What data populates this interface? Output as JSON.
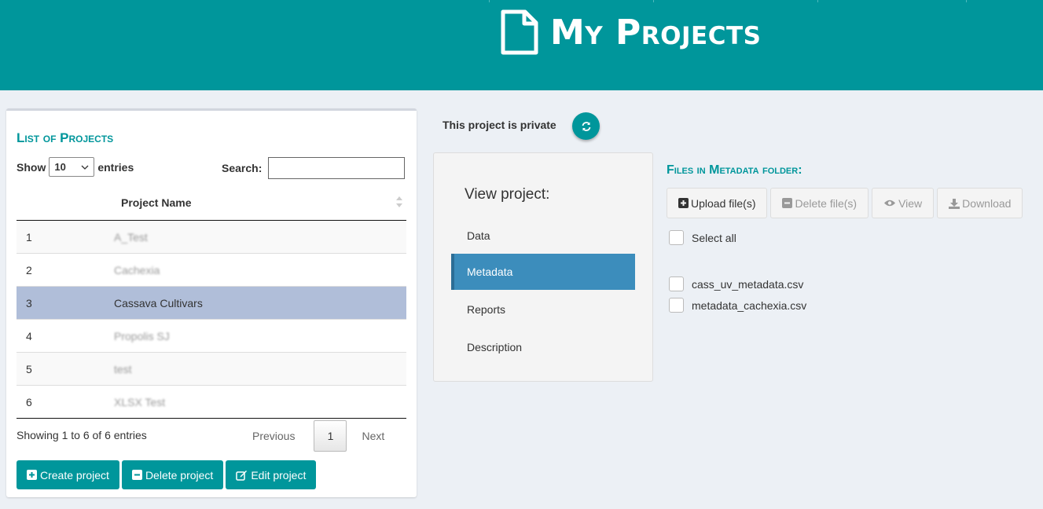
{
  "header": {
    "title": "My Projects",
    "icon": "file-icon"
  },
  "projects_panel": {
    "title": "List of Projects",
    "show_label": "Show",
    "entries_value": "10",
    "entries_label": "entries",
    "search_label": "Search:",
    "search_value": "",
    "column_header": "Project Name",
    "rows": [
      {
        "num": "1",
        "name": "A_Test"
      },
      {
        "num": "2",
        "name": "Cachexia"
      },
      {
        "num": "3",
        "name": "Cassava Cultivars"
      },
      {
        "num": "4",
        "name": "Propolis SJ"
      },
      {
        "num": "5",
        "name": "test"
      },
      {
        "num": "6",
        "name": "XLSX Test"
      }
    ],
    "info": "Showing 1 to 6 of 6 entries",
    "pager": {
      "previous": "Previous",
      "page": "1",
      "next": "Next"
    },
    "buttons": {
      "create": "Create project",
      "delete": "Delete project",
      "edit": "Edit project"
    }
  },
  "privacy": {
    "label": "This project is private",
    "icon": "refresh-icon"
  },
  "view_nav": {
    "title": "View project:",
    "items": [
      "Data",
      "Metadata",
      "Reports",
      "Description"
    ],
    "active": "Metadata"
  },
  "files": {
    "title": "Files in Metadata folder:",
    "buttons": {
      "upload": "Upload file(s)",
      "delete": "Delete file(s)",
      "view": "View",
      "download": "Download"
    },
    "select_all": "Select all",
    "list": [
      "cass_uv_metadata.csv",
      "metadata_cachexia.csv"
    ]
  },
  "colors": {
    "teal": "#00969b",
    "active_blue": "#3c8dbc",
    "selected_row": "#b0bed9"
  }
}
